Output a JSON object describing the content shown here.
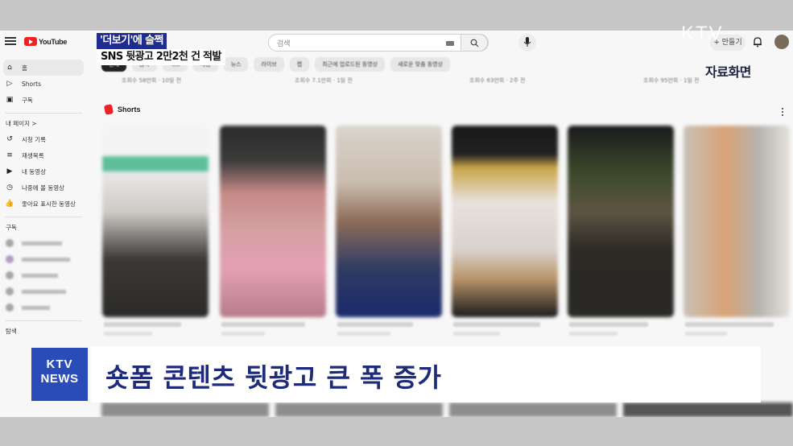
{
  "app": {
    "logo_text": "YouTube",
    "search_placeholder": "검색",
    "create_label": "+ 만들기"
  },
  "chips": [
    "전체",
    "음악",
    "믹스",
    "게임",
    "뉴스",
    "라이브",
    "랩",
    "최근에 업로드된 동영상",
    "새로운 맞춤 동영상"
  ],
  "sidebar": {
    "main": [
      {
        "icon": "home-icon",
        "label": "홈"
      },
      {
        "icon": "shorts-icon",
        "label": "Shorts"
      },
      {
        "icon": "subscriptions-icon",
        "label": "구독"
      }
    ],
    "you_title": "내 페이지 >",
    "you": [
      {
        "icon": "history-icon",
        "label": "시청 기록"
      },
      {
        "icon": "playlist-icon",
        "label": "재생목록"
      },
      {
        "icon": "my-videos-icon",
        "label": "내 동영상"
      },
      {
        "icon": "watch-later-icon",
        "label": "나중에 볼 동영상"
      },
      {
        "icon": "liked-icon",
        "label": "좋아요 표시한 동영상"
      }
    ],
    "subs_title": "구독",
    "explore_title": "탐색"
  },
  "meta": [
    "조회수 58만회 · 10일 전",
    "조회수 7.1만회 · 1일 전",
    "조회수 63만회 · 2주 전",
    "조회수 95만회 · 1일 전"
  ],
  "shorts": {
    "title": "Shorts"
  },
  "overlay": {
    "tag": "'더보기'에 슬쩍",
    "subtitle": "SNS 뒷광고 2만2천 건 적발",
    "data_label": "자료화면",
    "watermark": "KTV",
    "news_line1": "KTV",
    "news_line2": "NEWS",
    "headline": "숏폼 콘텐츠 뒷광고 큰 폭 증가"
  },
  "colors": {
    "tag_bg": "#1f2c8f",
    "news_bg": "#2a4cb8",
    "headline_text": "#1e2a7a"
  }
}
